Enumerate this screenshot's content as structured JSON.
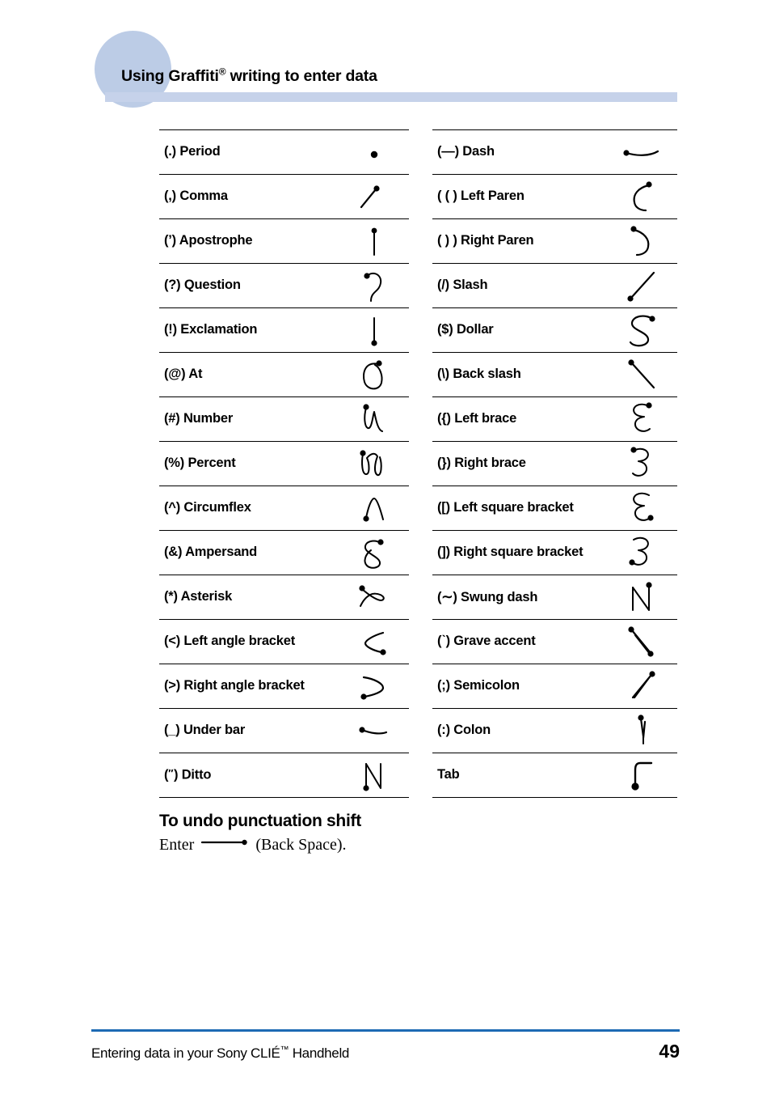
{
  "header": {
    "title_before": "Using Graffiti",
    "title_reg": "®",
    "title_after": " writing to enter data",
    "bar_color": "#c6d2ea",
    "circle_color": "#bccce6"
  },
  "tables": {
    "left": [
      {
        "label": "(.) Period",
        "glyph": "period-stroke"
      },
      {
        "label": "(,) Comma",
        "glyph": "comma-stroke"
      },
      {
        "label": "(’) Apostrophe",
        "glyph": "apostrophe-stroke"
      },
      {
        "label": "(?) Question",
        "glyph": "question-stroke"
      },
      {
        "label": "(!) Exclamation",
        "glyph": "exclamation-stroke"
      },
      {
        "label": "(@) At",
        "glyph": "at-stroke"
      },
      {
        "label": "(#) Number",
        "glyph": "number-stroke"
      },
      {
        "label": "(%) Percent",
        "glyph": "percent-stroke"
      },
      {
        "label": "(^) Circumflex",
        "glyph": "circumflex-stroke"
      },
      {
        "label": "(&) Ampersand",
        "glyph": "ampersand-stroke"
      },
      {
        "label": "(*) Asterisk",
        "glyph": "asterisk-stroke"
      },
      {
        "label": "(<) Left angle bracket",
        "glyph": "left-angle-bracket-stroke"
      },
      {
        "label": "(>) Right angle bracket",
        "glyph": "right-angle-bracket-stroke"
      },
      {
        "label": "(_) Under bar",
        "glyph": "under-bar-stroke"
      },
      {
        "label": "(″) Ditto",
        "glyph": "ditto-stroke"
      }
    ],
    "right": [
      {
        "label": "(—) Dash",
        "glyph": "dash-stroke"
      },
      {
        "label": "( ( ) Left Paren",
        "glyph": "left-paren-stroke"
      },
      {
        "label": "( ) ) Right Paren",
        "glyph": "right-paren-stroke"
      },
      {
        "label": "(/) Slash",
        "glyph": "slash-stroke"
      },
      {
        "label": "($) Dollar",
        "glyph": "dollar-stroke"
      },
      {
        "label": "(\\) Back slash",
        "glyph": "back-slash-stroke"
      },
      {
        "label": "({) Left brace",
        "glyph": "left-brace-stroke"
      },
      {
        "label": "(}) Right brace",
        "glyph": "right-brace-stroke"
      },
      {
        "label": "([) Left square bracket",
        "glyph": "left-square-bracket-stroke"
      },
      {
        "label": "(]) Right square bracket",
        "glyph": "right-square-bracket-stroke"
      },
      {
        "label": "(∼) Swung dash",
        "glyph": "swung-dash-stroke"
      },
      {
        "label": "(ˋ) Grave accent",
        "glyph": "grave-accent-stroke"
      },
      {
        "label": "(;) Semicolon",
        "glyph": "semicolon-stroke"
      },
      {
        "label": "(:) Colon",
        "glyph": "colon-stroke"
      },
      {
        "label": "Tab",
        "glyph": "tab-stroke"
      }
    ]
  },
  "undo": {
    "heading": "To undo punctuation shift",
    "prefix": "Enter",
    "suffix": "(Back Space)."
  },
  "footer": {
    "text_before": "Entering data in your Sony CLIÉ",
    "text_tm": "™",
    "text_after": " Handheld",
    "page_number": "49",
    "rule_color": "#1d6ab4"
  }
}
